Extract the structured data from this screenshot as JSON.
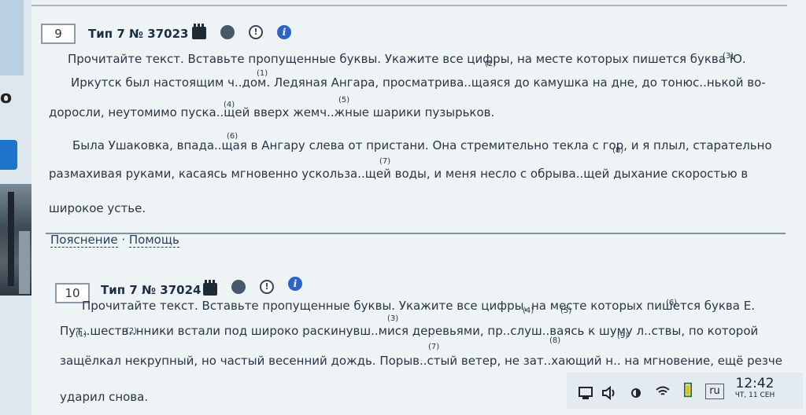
{
  "task9": {
    "number": "9",
    "header": "Тип 7 № 37023",
    "line1": "Прочитайте текст. Вставьте пропущенные буквы. Укажите все цифры, на месте которых пишется буква Ю.",
    "line2": "Иркутск был настоящим ч..дом. Ледяная Ангара, просматрива..щаяся до камушка на дне, до тонюс..нькой во-",
    "line3": "доросли, неутомимо пуска..щей вверх жемч..жные шарики пузырьков.",
    "line4": "Была Ушаковка, впада..щая в Ангару слева от пристани. Она стремительно текла с гор, и я плыл, старательно",
    "line5": "размахивая руками, касаясь мгновенно ускольза..щей воды, и меня несло с обрыва..щей дыхание скоростью в",
    "line6": "широкое устье.",
    "marks": [
      "(1)",
      "(2)",
      "(3)",
      "(4)",
      "(5)",
      "(6)",
      "(7)",
      "(8)"
    ],
    "explain_link": "Пояснение",
    "dot": "·",
    "help_link": "Помощь"
  },
  "task10": {
    "number": "10",
    "header": "Тип 7 № 37024",
    "line1": "Прочитайте текст. Вставьте пропущенные буквы. Укажите все цифры, на месте которых пишется буква Е.",
    "line2": "Пут..шеств..нники встали под широко раскинувш..мися деревьями, пр..слуш..ваясь к шуму л..ствы, по которой",
    "line3": "защёлкал некрупный, но частый весенний дождь. Порыв..стый ветер, не зат..хающий н.. на мгновение, ещё резче",
    "line4": "ударил снова.",
    "marks": [
      "(1)",
      "(2)",
      "(3)",
      "(4)",
      "(5)",
      "(6)",
      "(7)",
      "(8)",
      "(9)"
    ]
  },
  "sidebar": {
    "letter": "о"
  },
  "taskbar": {
    "lang": "ru",
    "time": "12:42",
    "date": "ЧТ, 11 СЕН",
    "icons": [
      "network-icon",
      "volume-icon",
      "brightness-icon",
      "wifi-icon",
      "battery-icon"
    ]
  }
}
